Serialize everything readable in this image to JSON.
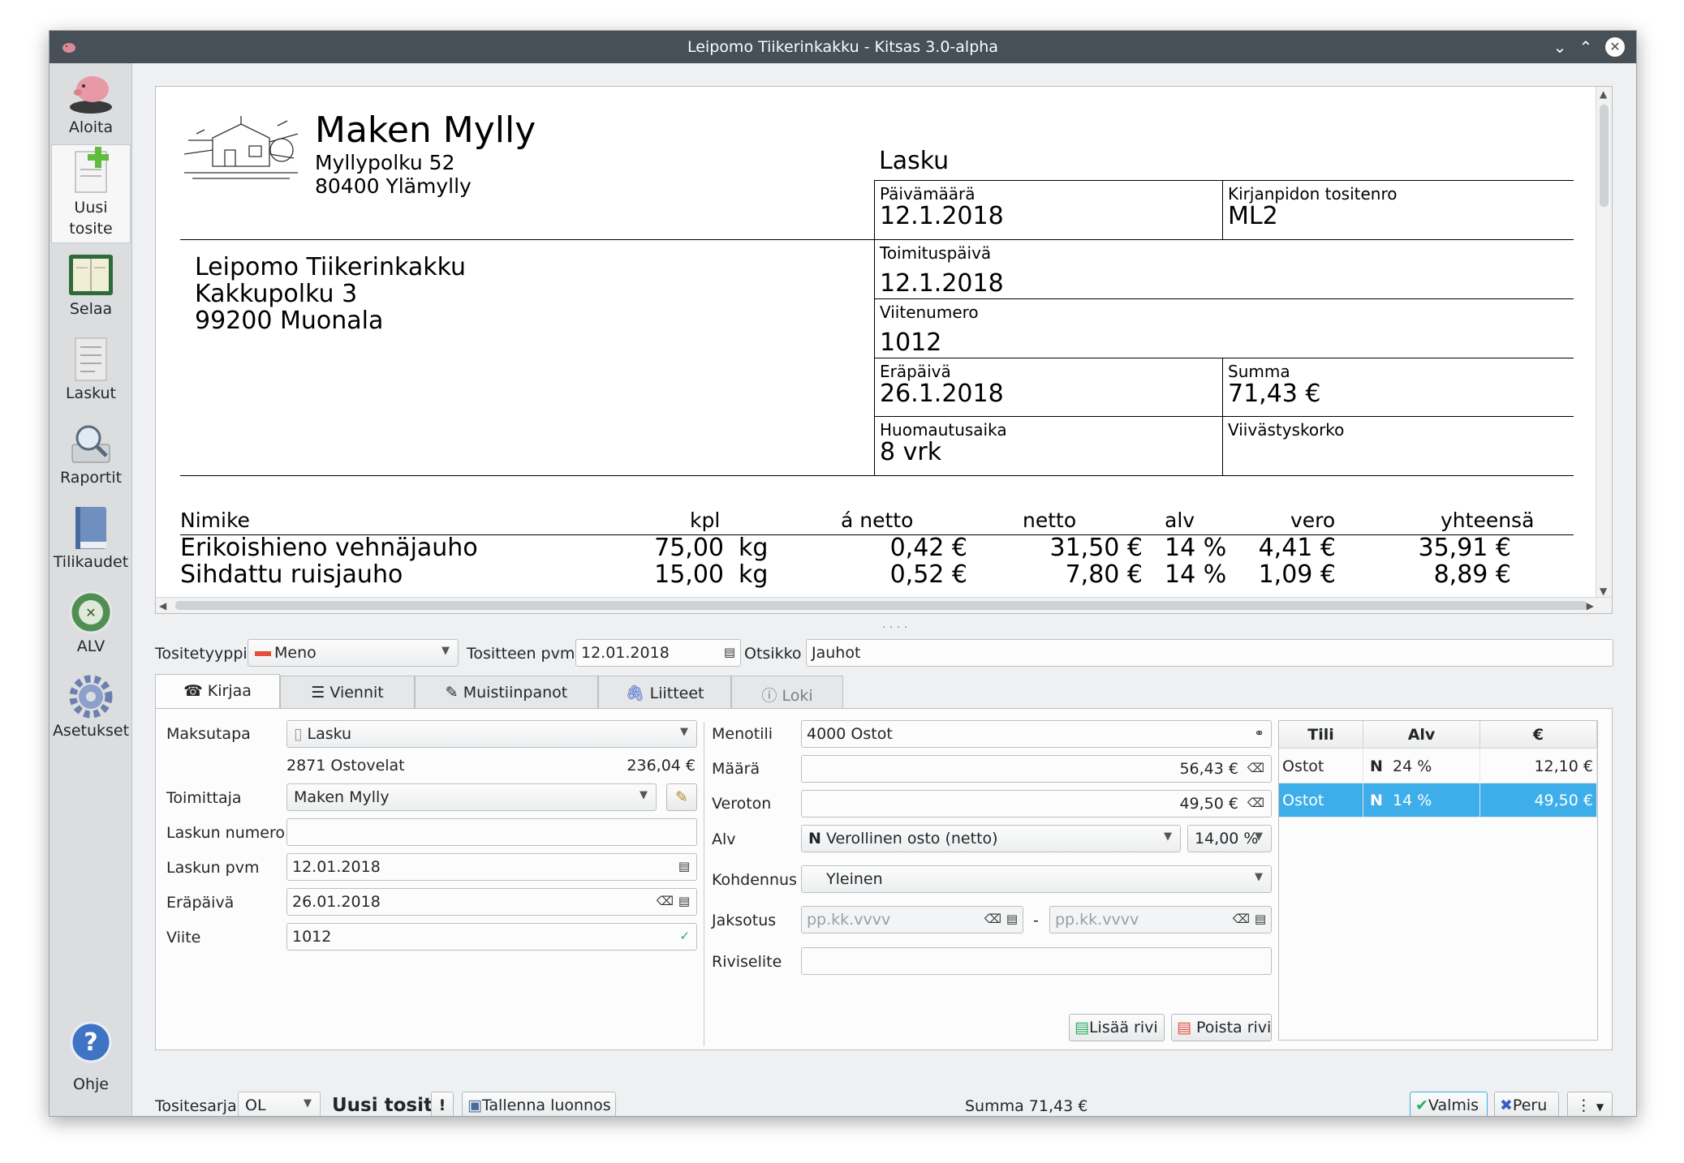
{
  "window": {
    "title": "Leipomo Tiikerinkakku - Kitsas 3.0-alpha"
  },
  "sidebar": {
    "items": [
      {
        "label": "Aloita"
      },
      {
        "label": "Uusi\ntosite"
      },
      {
        "label": "Selaa"
      },
      {
        "label": "Laskut"
      },
      {
        "label": "Raportit"
      },
      {
        "label": "Tilikaudet"
      },
      {
        "label": "ALV"
      },
      {
        "label": "Asetukset"
      }
    ],
    "help_label": "Ohje"
  },
  "invoice": {
    "company": "Maken Mylly",
    "company_street": "Myllypolku 52",
    "company_city": "80400 Ylämylly",
    "doc_title": "Lasku",
    "date_label": "Päivämäärä",
    "date_value": "12.1.2018",
    "voucher_label": "Kirjanpidon tositenro",
    "voucher_value": "ML2",
    "delivery_label": "Toimituspäivä",
    "delivery_value": "12.1.2018",
    "reference_label": "Viitenumero",
    "reference_value": "1012",
    "due_label": "Eräpäivä",
    "due_value": "26.1.2018",
    "total_label": "Summa",
    "total_value": "71,43 €",
    "notice_label": "Huomautusaika",
    "notice_value": "8 vrk",
    "interest_label": "Viivästyskorko",
    "customer_name": "Leipomo Tiikerinkakku",
    "customer_street": "Kakkupolku 3",
    "customer_city": "99200 Muonala",
    "columns": {
      "name": "Nimike",
      "qty": "kpl",
      "unit_net": "á netto",
      "net": "netto",
      "vat": "alv",
      "tax": "vero",
      "total": "yhteensä"
    },
    "rows": [
      {
        "name": "Erikoishieno vehnäjauho",
        "qty": "75,00",
        "unit": "kg",
        "unit_net": "0,42 €",
        "net": "31,50 €",
        "vat": "14 %",
        "tax": "4,41 €",
        "total": "35,91 €"
      },
      {
        "name": "Sihdattu ruisjauho",
        "qty": "15,00",
        "unit": "kg",
        "unit_net": "0,52 €",
        "net": "7,80 €",
        "vat": "14 %",
        "tax": "1,09 €",
        "total": "8,89 €"
      }
    ]
  },
  "header_form": {
    "type_label": "Tositetyyppi",
    "type_value": "Meno",
    "date_label": "Tositteen pvm",
    "date_value": "12.01.2018",
    "title_label": "Otsikko",
    "title_value": "Jauhot"
  },
  "tabs": [
    {
      "label": "Kirjaa"
    },
    {
      "label": "Viennit"
    },
    {
      "label": "Muistiinpanot"
    },
    {
      "label": "Liitteet"
    },
    {
      "label": "Loki"
    }
  ],
  "left_form": {
    "payment_label": "Maksutapa",
    "payment_value": "Lasku",
    "account_text": "2871 Ostovelat",
    "account_amount": "236,04 €",
    "supplier_label": "Toimittaja",
    "supplier_value": "Maken Mylly",
    "invoice_no_label": "Laskun numero",
    "invoice_no_value": "",
    "invoice_date_label": "Laskun pvm",
    "invoice_date_value": "12.01.2018",
    "due_label": "Eräpäivä",
    "due_value": "26.01.2018",
    "ref_label": "Viite",
    "ref_value": "1012"
  },
  "mid_form": {
    "expense_account_label": "Menotili",
    "expense_account_value": "4000 Ostot",
    "amount_label": "Määrä",
    "amount_value": "56,43 €",
    "net_label": "Veroton",
    "net_value": "49,50 €",
    "vat_label": "Alv",
    "vat_code": "N",
    "vat_value": "Verollinen osto (netto)",
    "vat_rate": "14,00 %",
    "allocation_label": "Kohdennus",
    "allocation_value": "Yleinen",
    "period_label": "Jaksotus",
    "period_start_placeholder": "pp.kk.vvvv",
    "period_dash": "-",
    "period_end_placeholder": "pp.kk.vvvv",
    "line_desc_label": "Riviselite",
    "line_desc_value": "",
    "add_row": "Lisää rivi",
    "remove_row": "Poista rivi"
  },
  "entries": {
    "headers": [
      "Tili",
      "Alv",
      "€"
    ],
    "rows": [
      {
        "account": "Ostot",
        "vat_code": "N",
        "vat_rate": "24 %",
        "amount": "12,10 €"
      },
      {
        "account": "Ostot",
        "vat_code": "N",
        "vat_rate": "14 %",
        "amount": "49,50 €"
      }
    ]
  },
  "bottom": {
    "series_label": "Tositesarja",
    "series_value": "OL",
    "new_voucher": "Uusi tosite",
    "alert": "!",
    "save_draft": "Tallenna luonnos",
    "sum_text": "Summa 71,43 €",
    "done": "Valmis",
    "cancel": "Peru",
    "more": "⋮"
  },
  "colors": {
    "accent": "#3daee9",
    "titlebar": "#475057",
    "sidebar": "#dcdddf"
  }
}
